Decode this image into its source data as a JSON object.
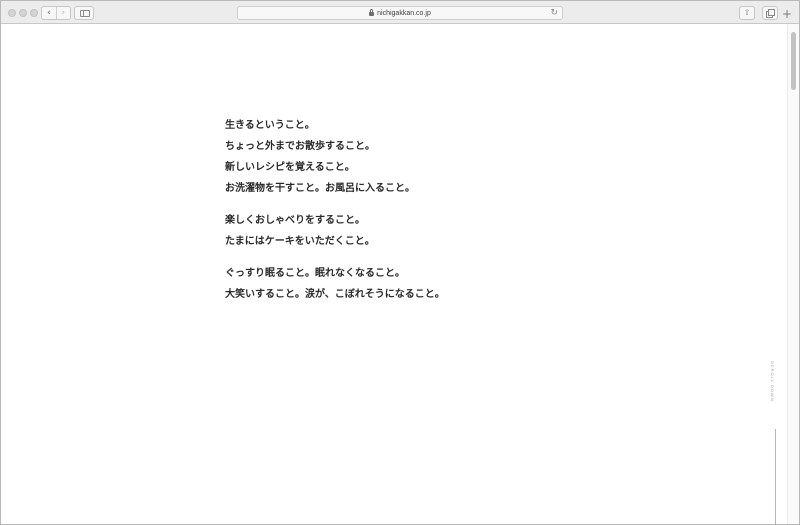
{
  "browser": {
    "url": "nichigakkan.co.jp",
    "icons": {
      "back": "chevron-left-icon",
      "forward": "chevron-right-icon",
      "sidebar": "sidebar-icon",
      "lock": "lock-icon",
      "reload": "reload-icon",
      "share": "share-icon",
      "tabs": "tabs-icon",
      "new_tab": "plus-icon"
    }
  },
  "poem": {
    "stanza1": [
      "生きるということ。",
      "ちょっと外までお散歩すること。",
      "新しいレシピを覚えること。",
      "お洗濯物を干すこと。お風呂に入ること。"
    ],
    "stanza2": [
      "楽しくおしゃべりをすること。",
      "たまにはケーキをいただくこと。"
    ],
    "stanza3": [
      "ぐっすり眠ること。眠れなくなること。",
      "大笑いすること。涙が、こぼれそうになること。"
    ]
  },
  "scroll_indicator": {
    "label": "SCROLL DOWN"
  }
}
